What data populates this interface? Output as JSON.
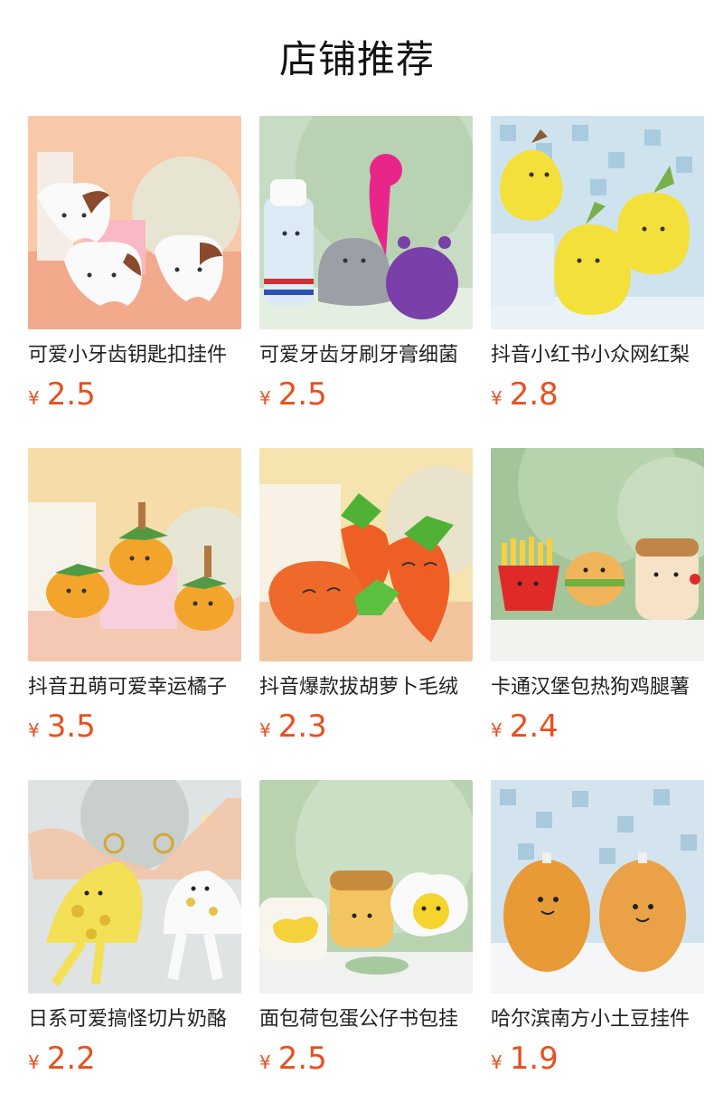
{
  "page_title": "店铺推荐",
  "currency_symbol": "¥",
  "products": [
    {
      "name": "可爱小牙齿钥匙扣挂件",
      "price": "2.5",
      "icon": "tooth-plush-image"
    },
    {
      "name": "可爱牙齿牙刷牙膏细菌",
      "price": "2.5",
      "icon": "toothpaste-plush-image"
    },
    {
      "name": "抖音小红书小众网红梨",
      "price": "2.8",
      "icon": "pear-plush-image"
    },
    {
      "name": "抖音丑萌可爱幸运橘子",
      "price": "3.5",
      "icon": "orange-plush-image"
    },
    {
      "name": "抖音爆款拔胡萝卜毛绒",
      "price": "2.3",
      "icon": "carrot-plush-image"
    },
    {
      "name": "卡通汉堡包热狗鸡腿薯",
      "price": "2.4",
      "icon": "fastfood-plush-image"
    },
    {
      "name": "日系可爱搞怪切片奶酪",
      "price": "2.2",
      "icon": "cheese-plush-image"
    },
    {
      "name": "面包荷包蛋公仔书包挂",
      "price": "2.5",
      "icon": "toast-egg-plush-image"
    },
    {
      "name": "哈尔滨南方小土豆挂件",
      "price": "1.9",
      "icon": "potato-plush-image"
    }
  ]
}
